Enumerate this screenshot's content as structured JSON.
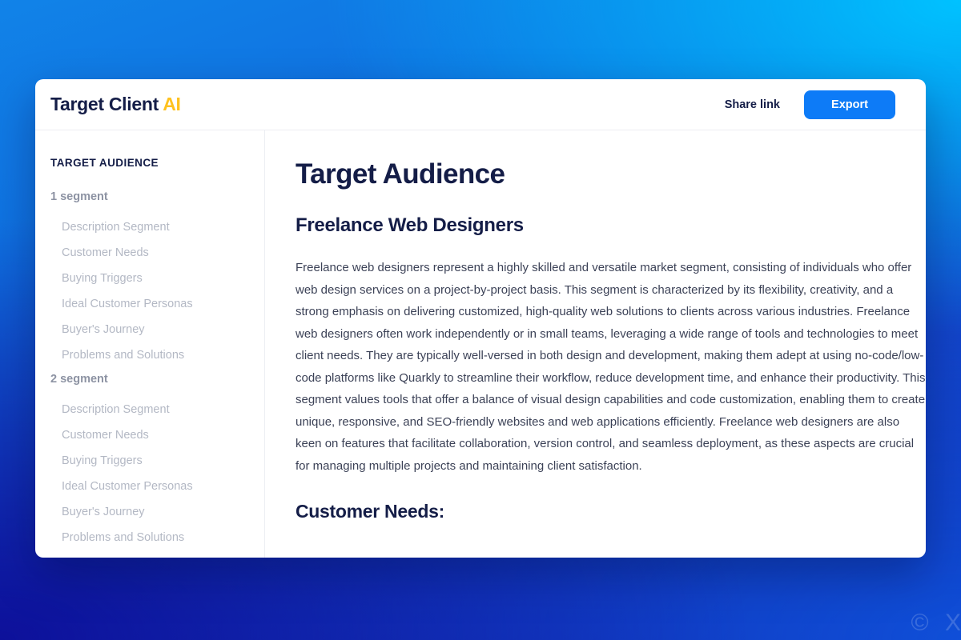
{
  "watermark": "© X",
  "header": {
    "brand_primary": "Target Client",
    "brand_accent": "AI",
    "share_label": "Share link",
    "export_label": "Export",
    "accent_color": "#ffc21f",
    "export_bg": "#0d7bf7"
  },
  "sidebar": {
    "title": "TARGET AUDIENCE",
    "groups": [
      {
        "label": "1 segment",
        "items": [
          "Description Segment",
          "Customer Needs",
          "Buying Triggers",
          "Ideal Customer Personas",
          "Buyer's Journey",
          "Problems and Solutions"
        ]
      },
      {
        "label": "2 segment",
        "items": [
          "Description Segment",
          "Customer Needs",
          "Buying Triggers",
          "Ideal Customer Personas",
          "Buyer's Journey",
          "Problems and Solutions"
        ]
      }
    ]
  },
  "main": {
    "page_title": "Target Audience",
    "section_heading": "Freelance Web Designers",
    "section_body": "Freelance web designers represent a highly skilled and versatile market segment, consisting of individuals who offer web design services on a project-by-project basis. This segment is characterized by its flexibility, creativity, and a strong emphasis on delivering customized, high-quality web solutions to clients across various industries. Freelance web designers often work independently or in small teams, leveraging a wide range of tools and technologies to meet client needs. They are typically well-versed in both design and development, making them adept at using no-code/low-code platforms like Quarkly to streamline their workflow, reduce development time, and enhance their productivity. This segment values tools that offer a balance of visual design capabilities and code customization, enabling them to create unique, responsive, and SEO-friendly websites and web applications efficiently. Freelance web designers are also keen on features that facilitate collaboration, version control, and seamless deployment, as these aspects are crucial for managing multiple projects and maintaining client satisfaction.",
    "subsection_heading": "Customer Needs:"
  }
}
